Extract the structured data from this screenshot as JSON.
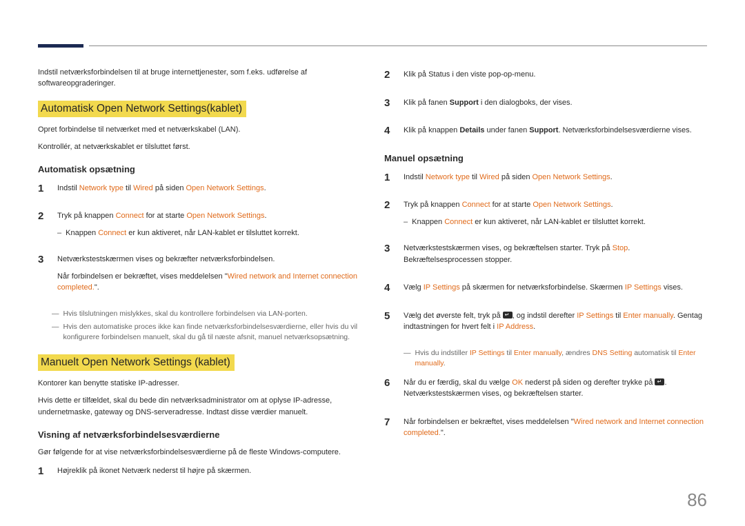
{
  "page_number": "86",
  "left": {
    "intro": "Indstil netværksforbindelsen til at bruge internettjenester, som f.eks. udførelse af softwareopgraderinger.",
    "chapter1": "Automatisk Open Network Settings(kablet)",
    "c1_line1": "Opret forbindelse til netværket med et netværkskabel (LAN).",
    "c1_line2": "Kontrollér, at netværkskablet er tilsluttet først.",
    "sub1": "Automatisk opsætning",
    "s1": {
      "pre": "Indstil ",
      "k1": "Network type",
      "mid1": " til ",
      "k2": "Wired",
      "mid2": " på siden ",
      "k3": "Open Network Settings",
      "post": "."
    },
    "s2": {
      "pre": "Tryk på knappen ",
      "k1": "Connect",
      "mid": " for at starte ",
      "k2": "Open Network Settings",
      "post": "."
    },
    "s2_dash": {
      "pre": "Knappen ",
      "k1": "Connect",
      "post": " er kun aktiveret, når LAN-kablet er tilsluttet korrekt."
    },
    "s3_a": "Netværkstestskærmen vises og bekræfter netværksforbindelsen.",
    "s3_b_pre": "Når forbindelsen er bekræftet, vises meddelelsen \"",
    "s3_b_k": "Wired network and Internet connection completed.",
    "s3_b_post": "\".",
    "foot1": "Hvis tilslutningen mislykkes, skal du kontrollere forbindelsen via LAN-porten.",
    "foot2": "Hvis den automatiske proces ikke kan finde netværksforbindelsesværdierne, eller hvis du vil konfigurere forbindelsen manuelt, skal du gå til næste afsnit, manuel netværksopsætning.",
    "chapter2": "Manuelt Open Network Settings (kablet)",
    "c2_line1": "Kontorer kan benytte statiske IP-adresser.",
    "c2_line2": "Hvis dette er tilfældet, skal du bede din netværksadministrator om at oplyse IP-adresse, undernetmaske, gateway og DNS-serveradresse. Indtast disse værdier manuelt.",
    "sub2": "Visning af netværksforbindelsesværdierne",
    "sub2_line": "Gør følgende for at vise netværksforbindelsesværdierne på de fleste Windows-computere.",
    "v_s1": "Højreklik på ikonet Netværk nederst til højre på skærmen."
  },
  "right": {
    "v_s2": "Klik på Status i den viste pop-op-menu.",
    "v_s3_pre": "Klik på fanen ",
    "v_s3_b": "Support",
    "v_s3_post": " i den dialogboks, der vises.",
    "v_s4_pre": "Klik på knappen ",
    "v_s4_b1": "Details",
    "v_s4_mid": " under fanen ",
    "v_s4_b2": "Support",
    "v_s4_post": ". Netværksforbindelsesværdierne vises.",
    "sub3": "Manuel opsætning",
    "m1": {
      "pre": "Indstil ",
      "k1": "Network type",
      "mid1": " til ",
      "k2": "Wired",
      "mid2": " på siden ",
      "k3": "Open Network Settings",
      "post": "."
    },
    "m2": {
      "pre": "Tryk på knappen ",
      "k1": "Connect",
      "mid": " for at starte ",
      "k2": "Open Network Settings",
      "post": "."
    },
    "m2_dash": {
      "pre": "Knappen ",
      "k1": "Connect",
      "post": " er kun aktiveret, når LAN-kablet er tilsluttet korrekt."
    },
    "m3_pre": "Netværkstestskærmen vises, og bekræftelsen starter. Tryk på ",
    "m3_k": "Stop",
    "m3_post": ". Bekræftelsesprocessen stopper.",
    "m4_pre": "Vælg ",
    "m4_k1": "IP Settings",
    "m4_mid": " på skærmen for netværksforbindelse. Skærmen ",
    "m4_k2": "IP Settings",
    "m4_post": " vises.",
    "m5_pre": "Vælg det øverste felt, tryk på ",
    "m5_mid1": ", og indstil derefter ",
    "m5_k1": "IP Settings",
    "m5_mid2": " til ",
    "m5_k2": "Enter manually",
    "m5_mid3": ". Gentag indtastningen for hvert felt i ",
    "m5_k3": "IP Address",
    "m5_post": ".",
    "m5_dash_pre": "Hvis du indstiller ",
    "m5_dash_k1": "IP Settings",
    "m5_dash_mid1": " til ",
    "m5_dash_k2": "Enter manually",
    "m5_dash_mid2": ", ændres ",
    "m5_dash_k3": "DNS Setting",
    "m5_dash_mid3": " automatisk til ",
    "m5_dash_k4": "Enter manually",
    "m5_dash_post": ".",
    "m6_pre": "Når du er færdig, skal du vælge ",
    "m6_k": "OK",
    "m6_mid": " nederst på siden og derefter trykke på ",
    "m6_post": ". Netværkstestskærmen vises, og bekræftelsen starter.",
    "m7_pre": "Når forbindelsen er bekræftet, vises meddelelsen \"",
    "m7_k": "Wired network and Internet connection completed.",
    "m7_post": "\"."
  }
}
